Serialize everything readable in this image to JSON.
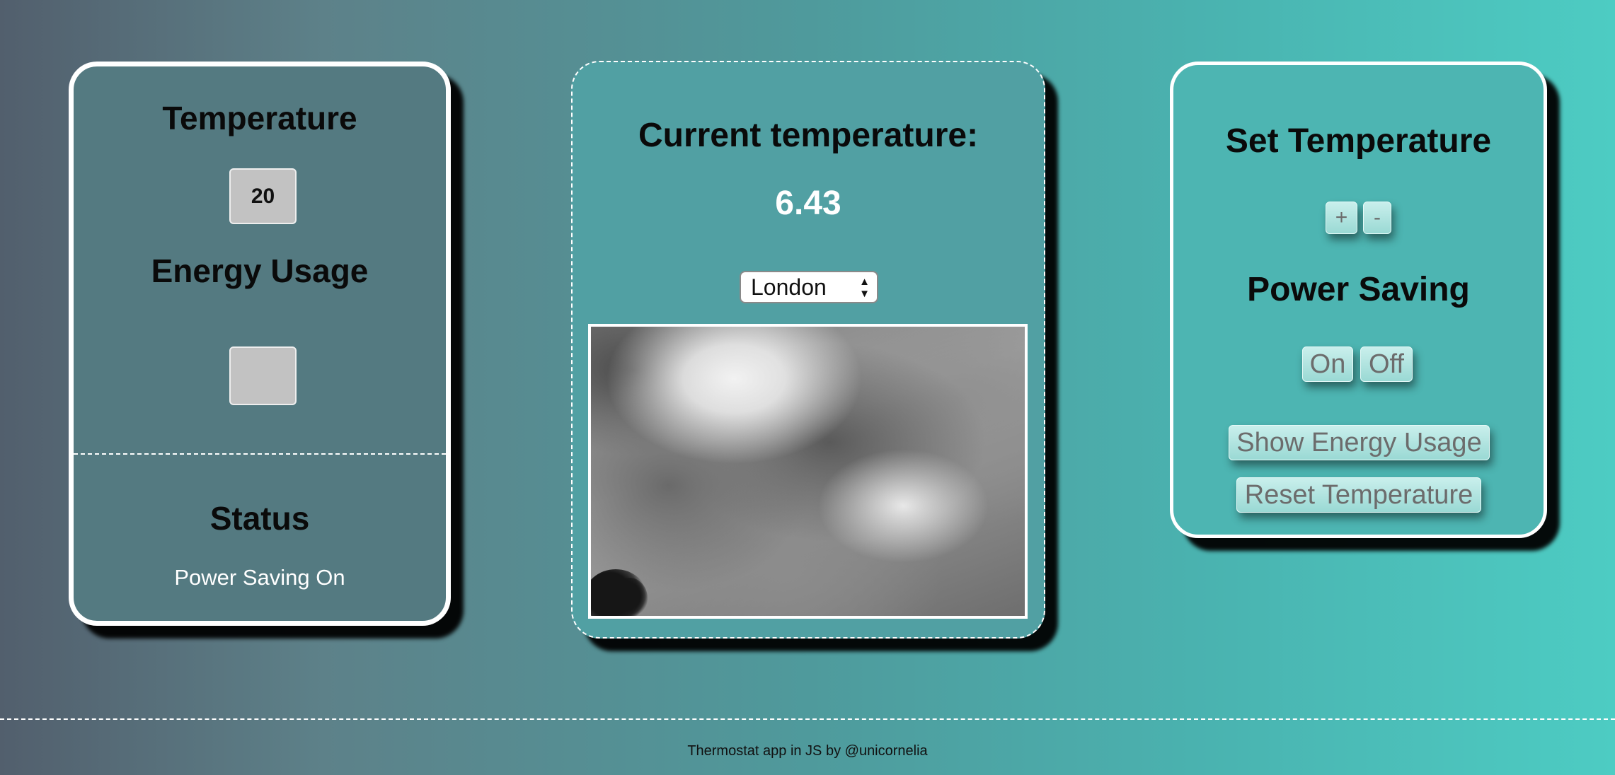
{
  "temperature_panel": {
    "title": "Temperature",
    "value": "20",
    "energy_title": "Energy Usage",
    "energy_value": "",
    "status_title": "Status",
    "status_text": "Power Saving On"
  },
  "weather_panel": {
    "title": "Current temperature:",
    "value": "6.43",
    "city_select": {
      "selected": "London"
    },
    "image": {
      "description": "cloudy-sky"
    }
  },
  "controls_panel": {
    "title": "Set Temperature",
    "increase_label": "+",
    "decrease_label": "-",
    "power_saving_title": "Power Saving",
    "on_label": "On",
    "off_label": "Off",
    "show_energy_label": "Show Energy Usage",
    "reset_label": "Reset Temperature"
  },
  "footer": {
    "text": "Thermostat app in JS by @unicornelia"
  },
  "colors": {
    "panel_border": "#ffffff",
    "button_bg": "#a8e0db",
    "button_text": "#6c6c6c",
    "display_box_bg": "#c2c2c2"
  }
}
